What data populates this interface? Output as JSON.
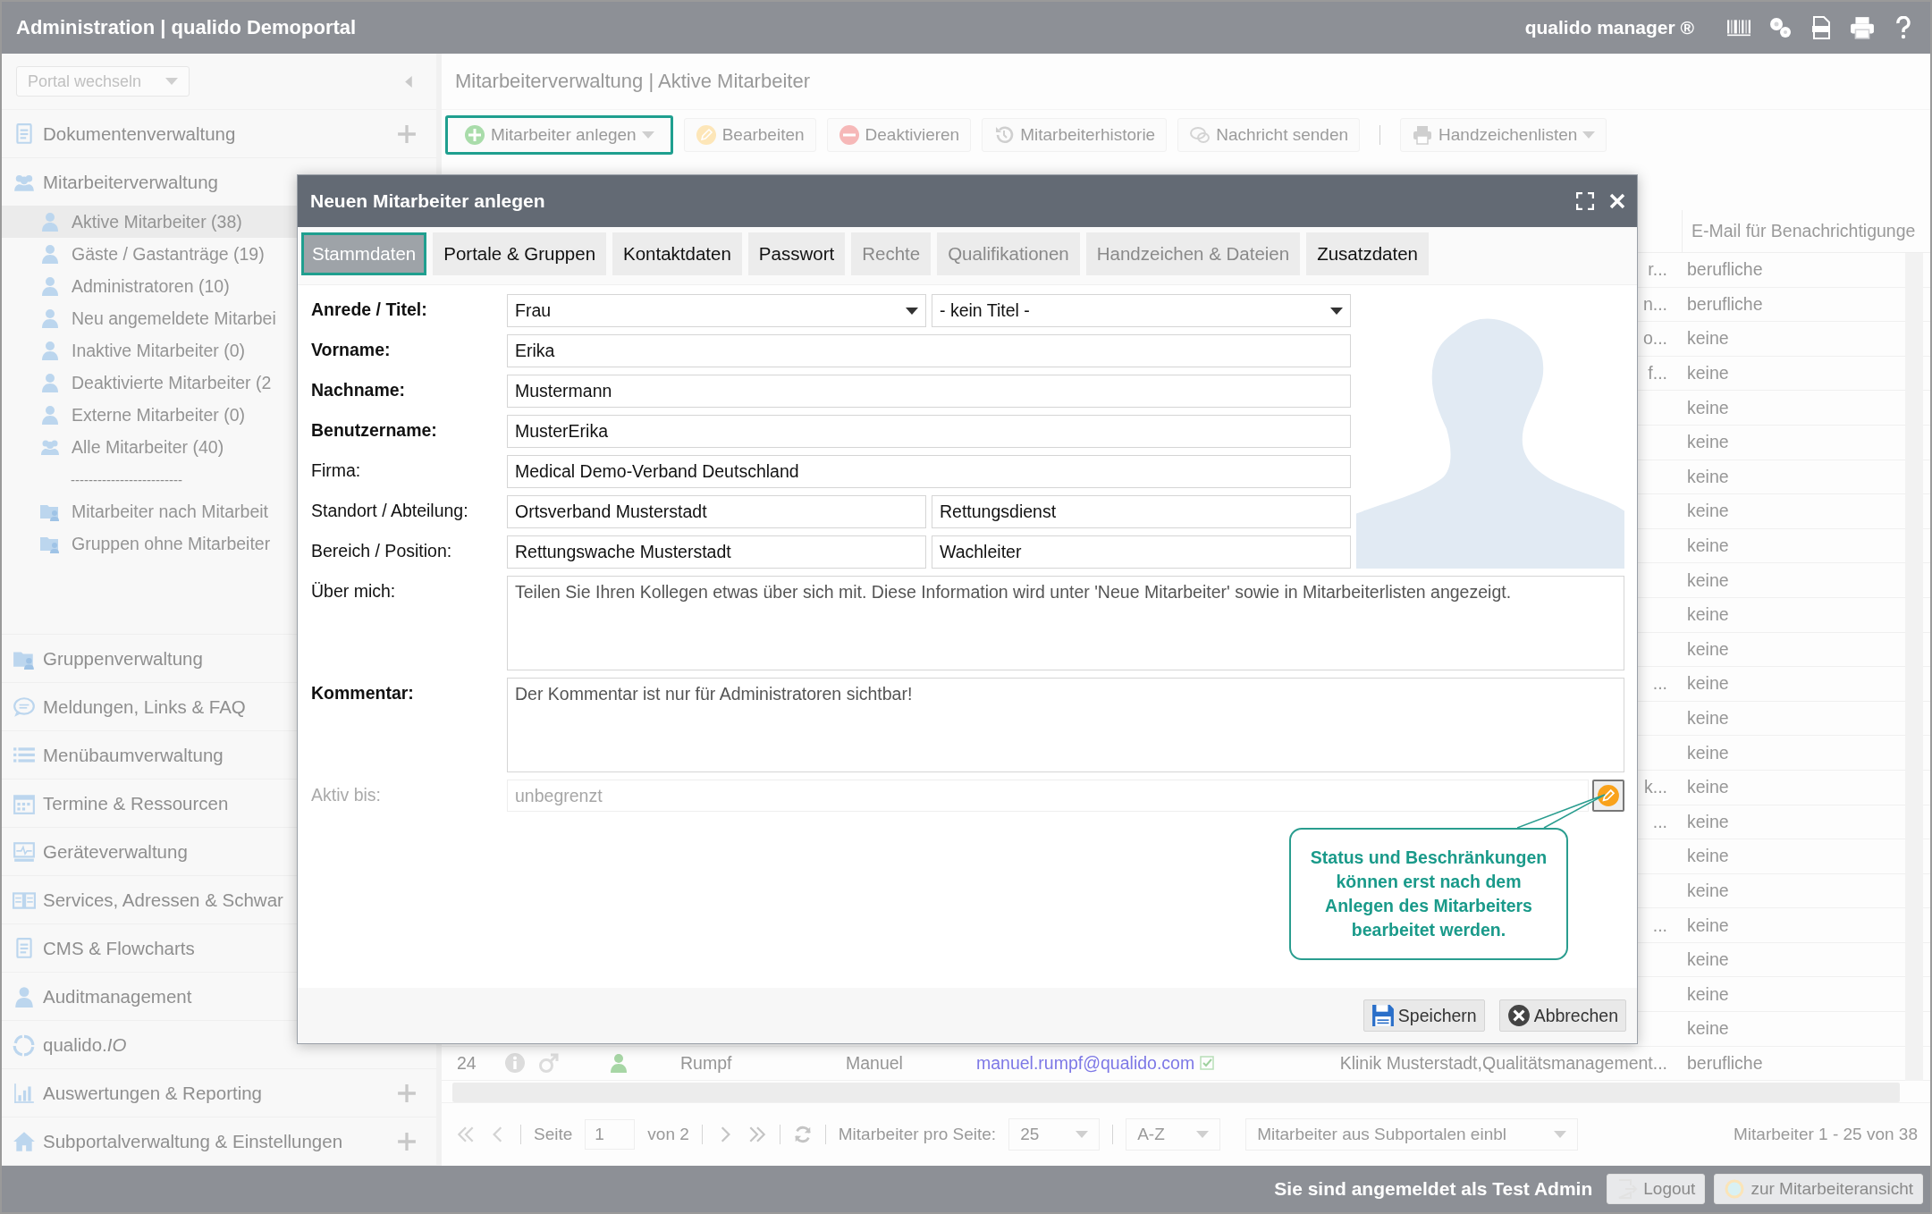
{
  "topbar": {
    "title": "Administration | qualido Demoportal",
    "brand": "qualido manager ®"
  },
  "sidebar": {
    "portal_select": "Portal wechseln",
    "sections": [
      {
        "label": "Dokumentenverwaltung",
        "plus": true
      },
      {
        "label": "Mitarbeiterverwaltung",
        "plus": false,
        "children": [
          {
            "kind": "item",
            "label": "Aktive Mitarbeiter (38)",
            "selected": true
          },
          {
            "kind": "item",
            "label": "Gäste / Gastanträge (19)",
            "selected": false
          },
          {
            "kind": "item",
            "label": "Administratoren (10)",
            "selected": false
          },
          {
            "kind": "item",
            "label": "Neu angemeldete Mitarbei",
            "selected": false
          },
          {
            "kind": "item",
            "label": "Inaktive Mitarbeiter (0)",
            "selected": false
          },
          {
            "kind": "item",
            "label": "Deaktivierte Mitarbeiter (2",
            "selected": false
          },
          {
            "kind": "item",
            "label": "Externe Mitarbeiter (0)",
            "selected": false
          },
          {
            "kind": "item",
            "label": "Alle Mitarbeiter (40)",
            "selected": false
          },
          {
            "kind": "separator",
            "label": "-------------------------"
          },
          {
            "kind": "item",
            "label": "Mitarbeiter nach Mitarbeit",
            "selected": false
          },
          {
            "kind": "item",
            "label": "Gruppen ohne Mitarbeiter",
            "selected": false
          }
        ]
      },
      {
        "label": "Gruppenverwaltung",
        "plus": false
      },
      {
        "label": "Meldungen, Links & FAQ",
        "plus": false
      },
      {
        "label": "Menübaumverwaltung",
        "plus": false
      },
      {
        "label": "Termine & Ressourcen",
        "plus": false
      },
      {
        "label": "Geräteverwaltung",
        "plus": false
      },
      {
        "label": "Services, Adressen & Schwar",
        "plus": false
      },
      {
        "label": "CMS & Flowcharts",
        "plus": false
      },
      {
        "label": "Auditmanagement",
        "plus": false
      },
      {
        "label": "qualido.*IO*",
        "plus": false
      },
      {
        "label": "Auswertungen & Reporting",
        "plus": true
      },
      {
        "label": "Subportalverwaltung & Einstellungen",
        "plus": true
      }
    ]
  },
  "main": {
    "breadcrumb": "Mitarbeiterverwaltung | Aktive Mitarbeiter",
    "toolbar": [
      {
        "label": "Mitarbeiter anlegen",
        "focused": true,
        "dropdown": true
      },
      {
        "label": "Bearbeiten",
        "focused": false,
        "dropdown": false
      },
      {
        "label": "Deaktivieren",
        "focused": false,
        "dropdown": false
      },
      {
        "label": "Mitarbeiterhistorie",
        "focused": false,
        "dropdown": false
      },
      {
        "label": "Nachricht senden",
        "focused": false,
        "dropdown": false
      },
      {
        "label": "Handzeichenlisten",
        "focused": false,
        "dropdown": true
      }
    ],
    "table": {
      "column_7_header": "E-Mail für Benachrichtigunge",
      "rows": [
        {
          "column_6": "r...",
          "column_7": "berufliche"
        },
        {
          "column_6": "n...",
          "column_7": "berufliche"
        },
        {
          "column_6": "o...",
          "column_7": "keine"
        },
        {
          "column_6": "f...",
          "column_7": "keine"
        },
        {
          "column_7": "keine"
        },
        {
          "column_7": "keine"
        },
        {
          "column_7": "keine"
        },
        {
          "column_7": "keine"
        },
        {
          "column_7": "keine"
        },
        {
          "column_7": "keine"
        },
        {
          "column_7": "keine"
        },
        {
          "column_7": "keine"
        },
        {
          "column_6": "...",
          "column_7": "keine"
        },
        {
          "column_7": "keine"
        },
        {
          "column_7": "keine"
        },
        {
          "column_6": "k...",
          "column_7": "keine"
        },
        {
          "column_6": "...",
          "column_7": "keine"
        },
        {
          "column_7": "keine"
        },
        {
          "column_7": "keine"
        },
        {
          "column_6": "...",
          "column_7": "keine"
        },
        {
          "column_7": "keine"
        },
        {
          "column_7": "keine"
        },
        {
          "column_7": "keine"
        },
        {
          "column_1": "24",
          "column_3": "Rumpf",
          "column_4": "Manuel",
          "column_5": "manuel.rumpf@qualido.com",
          "email_confirmed": true,
          "column_6": "Klinik Musterstadt,Qualitätsmanagement...",
          "column_7": "berufliche"
        }
      ]
    },
    "pagination": {
      "page_label": "Seite",
      "page": "1",
      "of": "von 2",
      "per_page_label": "Mitarbeiter pro Seite:",
      "per_page": "25",
      "sort": "A-Z",
      "subportal_select": "Mitarbeiter aus Subportalen einbl",
      "range": "Mitarbeiter 1 - 25 von 38"
    }
  },
  "footer": {
    "login_text": "Sie sind angemeldet als Test Admin",
    "logout": "Logout",
    "view_button": "zur Mitarbeiteransicht"
  },
  "dialog": {
    "title": "Neuen Mitarbeiter anlegen",
    "tabs": [
      {
        "label": "Stammdaten",
        "selected": true,
        "disabled": false
      },
      {
        "label": "Portale & Gruppen",
        "selected": false,
        "disabled": false
      },
      {
        "label": "Kontaktdaten",
        "selected": false,
        "disabled": false
      },
      {
        "label": "Passwort",
        "selected": false,
        "disabled": false
      },
      {
        "label": "Rechte",
        "selected": false,
        "disabled": true
      },
      {
        "label": "Qualifikationen",
        "selected": false,
        "disabled": true
      },
      {
        "label": "Handzeichen & Dateien",
        "selected": false,
        "disabled": true
      },
      {
        "label": "Zusatzdaten",
        "selected": false,
        "disabled": false
      }
    ],
    "fields": [
      {
        "kind": "selects",
        "label": "Anrede / Titel:",
        "required": true,
        "values": [
          "Frau",
          "- kein Titel -"
        ]
      },
      {
        "kind": "text",
        "label": "Vorname:",
        "required": true,
        "value": "Erika"
      },
      {
        "kind": "text",
        "label": "Nachname:",
        "required": true,
        "value": "Mustermann"
      },
      {
        "kind": "text",
        "label": "Benutzername:",
        "required": true,
        "value": "MusterErika"
      },
      {
        "kind": "text",
        "label": "Firma:",
        "required": false,
        "value": "Medical Demo-Verband Deutschland"
      },
      {
        "kind": "pair",
        "label": "Standort / Abteilung:",
        "required": false,
        "values": [
          "Ortsverband Musterstadt",
          "Rettungsdienst"
        ]
      },
      {
        "kind": "pair",
        "label": "Bereich / Position:",
        "required": false,
        "values": [
          "Rettungswache Musterstadt",
          "Wachleiter"
        ]
      },
      {
        "kind": "textarea",
        "label": "Über mich:",
        "required": false,
        "placeholder": "Teilen Sie Ihren Kollegen etwas über sich mit. Diese Information wird unter 'Neue Mitarbeiter' sowie in Mitarbeiterlisten angezeigt."
      },
      {
        "kind": "textarea",
        "label": "Kommentar:",
        "required": true,
        "placeholder": "Der Kommentar ist nur für Administratoren sichtbar!"
      },
      {
        "kind": "locked",
        "label": "Aktiv bis:",
        "required": false,
        "placeholder": "unbegrenzt",
        "disabled": true
      }
    ],
    "tooltip": "Status und Beschränkungen können erst nach dem Anlegen des Mitarbeiters bearbeitet werden.",
    "buttons": [
      "Speichern",
      "Abbrechen"
    ]
  }
}
